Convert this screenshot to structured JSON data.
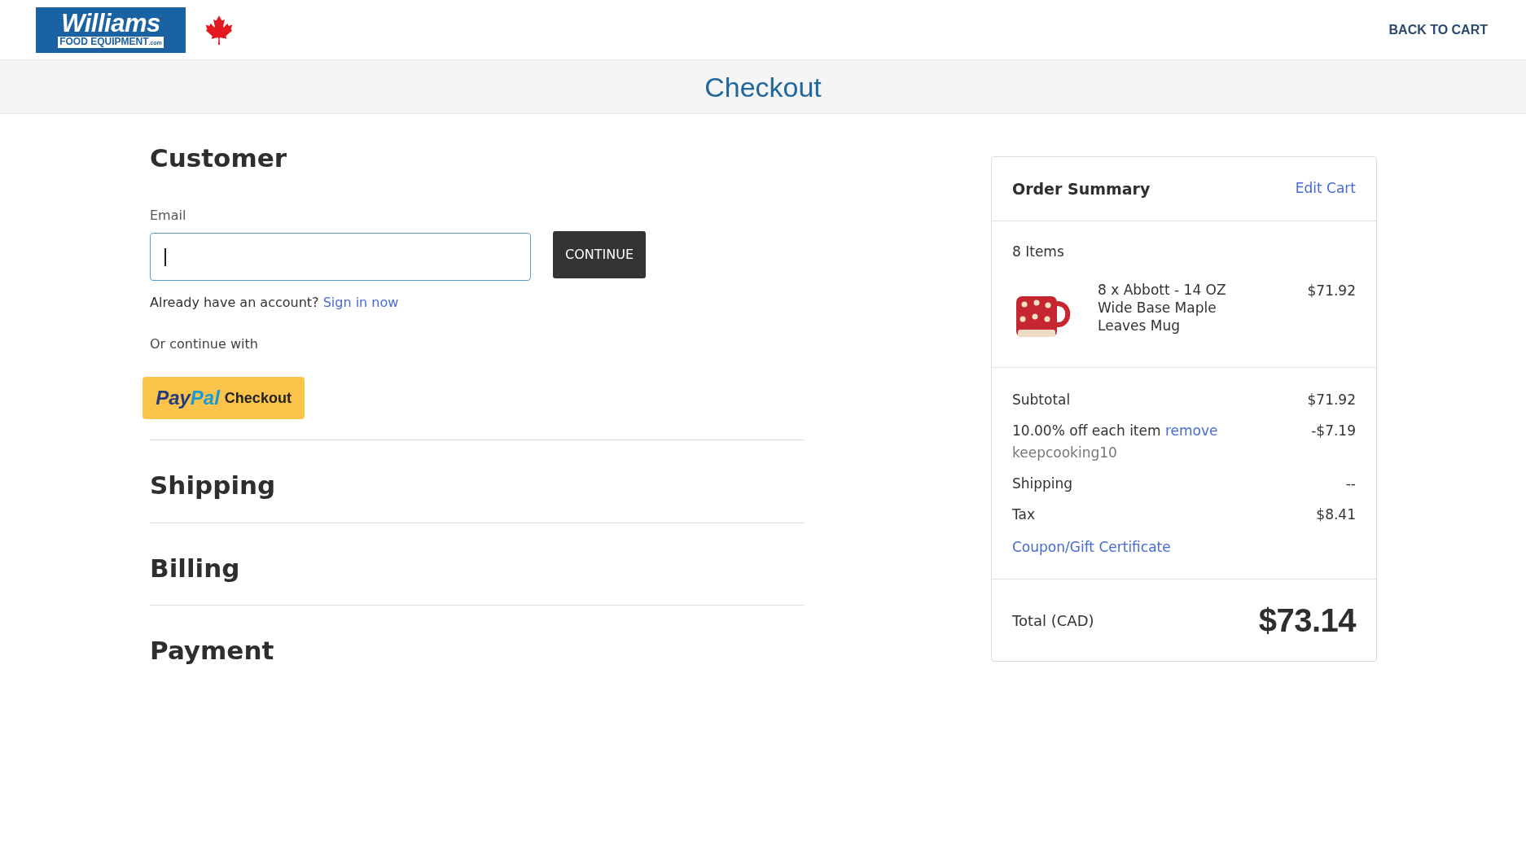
{
  "header": {
    "logo": {
      "name": "Williams",
      "tagline": "FOOD EQUIPMENT",
      "suffix": ".com"
    },
    "back_link": "BACK TO CART"
  },
  "page_title": "Checkout",
  "customer": {
    "heading": "Customer",
    "email": {
      "label": "Email",
      "focused": true
    },
    "continue_button": "CONTINUE",
    "account_prompt": "Already have an account?",
    "sign_in_link": "Sign in now",
    "alt_prompt": "Or continue with",
    "paypal_button": {
      "logo": [
        "Pay",
        "Pal"
      ],
      "label": "Checkout"
    }
  },
  "steps": [
    {
      "heading": "Shipping"
    },
    {
      "heading": "Billing"
    },
    {
      "heading": "Payment"
    }
  ],
  "order_summary": {
    "title": "Order Summary",
    "edit_link": "Edit Cart",
    "item_count": "8 Items",
    "items": [
      {
        "name": "8 x Abbott - 14 OZ Wide Base Maple Leaves Mug",
        "price": "$71.92"
      }
    ],
    "lines": [
      {
        "kind": "plain",
        "label": "Subtotal",
        "value": "$71.92"
      },
      {
        "kind": "discount",
        "label": "10.00% off each item",
        "link": "remove",
        "code": "keepcooking10",
        "value": "-$7.19"
      },
      {
        "kind": "plain",
        "label": "Shipping",
        "value": "--"
      },
      {
        "kind": "plain",
        "label": "Tax",
        "value": "$8.41"
      }
    ],
    "coupon_link": "Coupon/Gift Certificate",
    "total": {
      "label": "Total (CAD)",
      "value": "$73.14"
    }
  }
}
